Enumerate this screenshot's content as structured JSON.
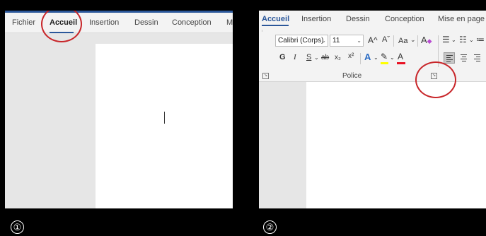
{
  "step1": {
    "number": "①",
    "tabs": [
      "Fichier",
      "Accueil",
      "Insertion",
      "Dessin",
      "Conception",
      "M"
    ],
    "active_tab": "Accueil",
    "accent": "#2b579a",
    "highlight": "#c8262a"
  },
  "step2": {
    "number": "②",
    "tabs": [
      "Accueil",
      "Insertion",
      "Dessin",
      "Conception",
      "Mise en page"
    ],
    "active_tab": "Accueil",
    "font_name": "Calibri (Corps)",
    "font_size": "11",
    "grow_font": "A^",
    "shrink_font": "Aˇ",
    "change_case": "Aa",
    "bold": "G",
    "italic": "I",
    "underline": "S",
    "strikethrough": "ab",
    "subscript": "x₂",
    "superscript": "x²",
    "group_label": "Police",
    "icons": {
      "clear-format": "eraser-icon",
      "text-effects": "text-effects-icon",
      "highlight": "highlighter-icon",
      "font-color": "font-color-icon",
      "bullets": "bullets-icon",
      "numbering": "numbering-icon",
      "launcher": "dialog-launcher-icon"
    }
  }
}
